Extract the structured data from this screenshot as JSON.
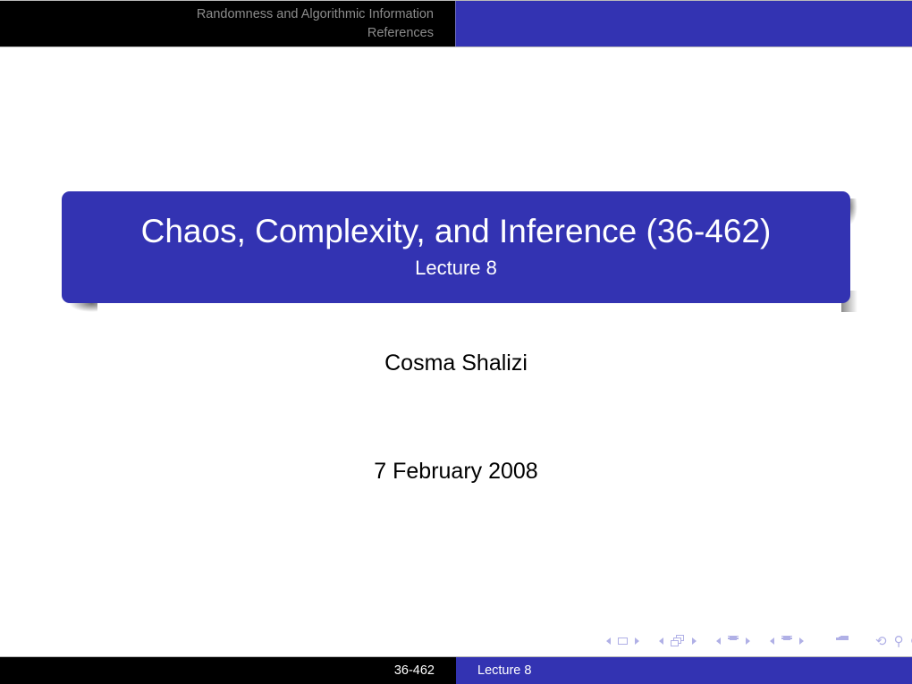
{
  "headline": {
    "section": "Randomness and Algorithmic Information",
    "subsection": "References"
  },
  "titlepage": {
    "title": "Chaos, Complexity, and Inference (36-462)",
    "subtitle": "Lecture 8",
    "author": "Cosma Shalizi",
    "date": "7 February 2008"
  },
  "navigation": {
    "icons": [
      "frame-prev",
      "frame",
      "frame-next",
      "subsection-prev",
      "subsection",
      "subsection-next",
      "section-prev",
      "section",
      "section-next",
      "subsection-prev2",
      "subsection2",
      "subsection-next2",
      "document",
      "back",
      "search",
      "forward"
    ],
    "search_glyphs": {
      "back": "⟲",
      "search": "⚲",
      "forward": "⟳"
    }
  },
  "footline": {
    "course": "36-462",
    "short_title": "Lecture 8"
  },
  "colors": {
    "structure": "#3333b2",
    "background": "#ffffff",
    "headline_bg": "#000000",
    "headline_text": "#8c8c8c",
    "nav_icons": "#b0b0e6"
  }
}
